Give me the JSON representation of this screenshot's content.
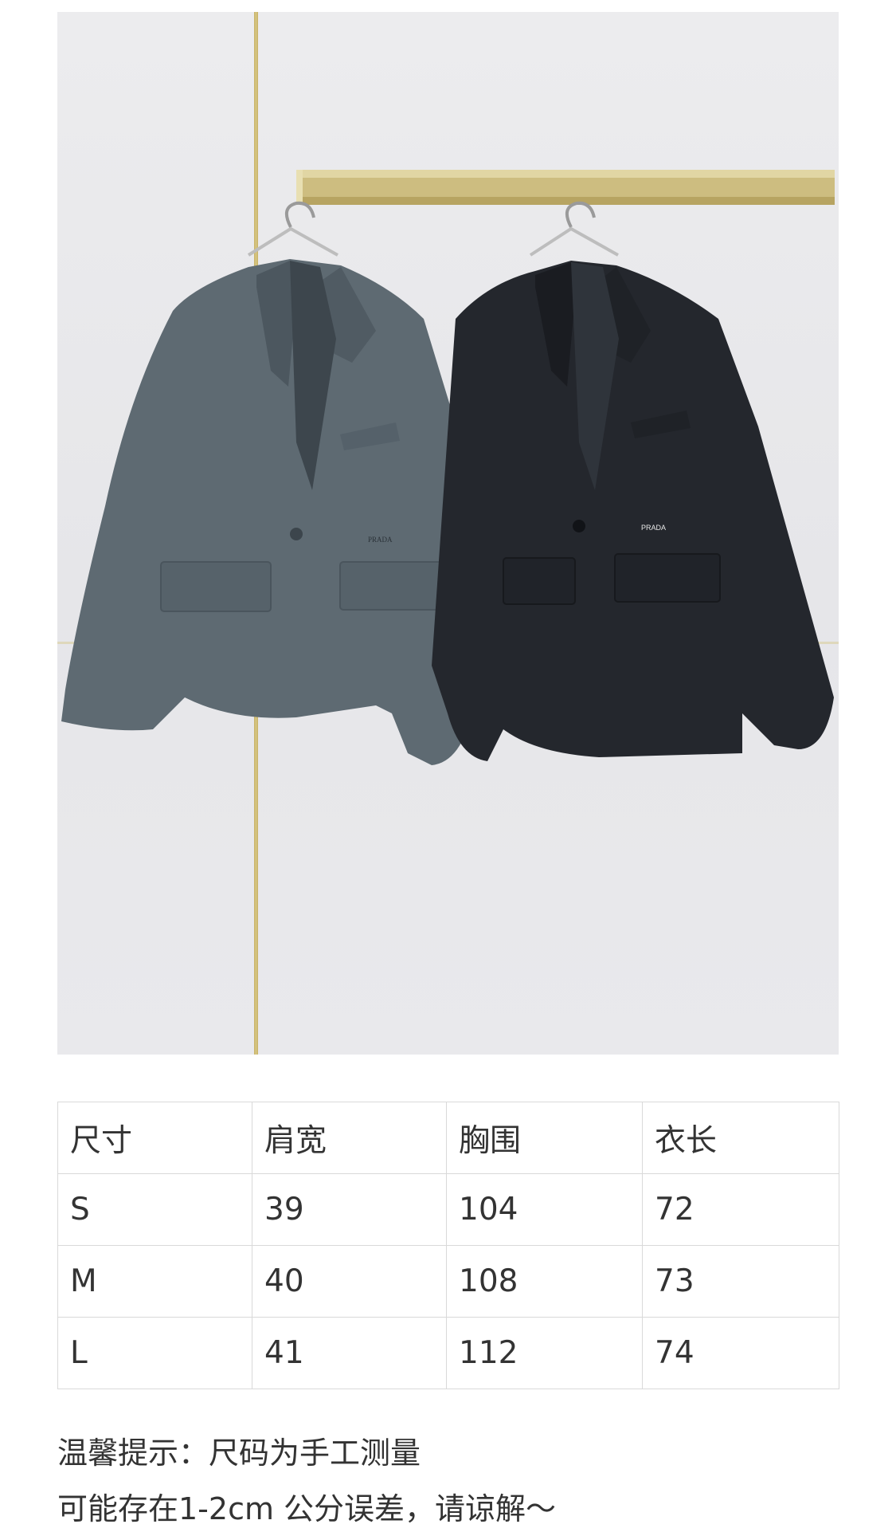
{
  "product_photo": {
    "subject": "two blazers on hangers",
    "left_blazer_color": "#5d6870",
    "right_blazer_color": "#23262c",
    "left_logo": "PRADA",
    "right_logo": "PRADA"
  },
  "size_table": {
    "headers": [
      "尺寸",
      "肩宽",
      "胸围",
      "衣长"
    ],
    "rows": [
      [
        "S",
        "39",
        "104",
        "72"
      ],
      [
        "M",
        "40",
        "108",
        "73"
      ],
      [
        "L",
        "41",
        "112",
        "74"
      ]
    ]
  },
  "notes": {
    "line1": "温馨提示：尺码为手工测量",
    "line2": "可能存在1-2cm 公分误差，请谅解～"
  }
}
